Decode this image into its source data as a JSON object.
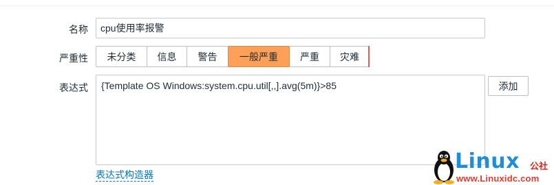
{
  "form": {
    "name": {
      "label": "名称",
      "value": "cpu使用率报警"
    },
    "severity": {
      "label": "严重性",
      "options": [
        {
          "label": "未分类",
          "selected": false,
          "color": "#97aab3"
        },
        {
          "label": "信息",
          "selected": false,
          "color": "#7499ff"
        },
        {
          "label": "警告",
          "selected": false,
          "color": "#ffc859"
        },
        {
          "label": "一般严重",
          "selected": true,
          "color": "#ffa059"
        },
        {
          "label": "严重",
          "selected": false,
          "color": "#e97659"
        },
        {
          "label": "灾难",
          "selected": false,
          "color": "#e45959"
        }
      ]
    },
    "expression": {
      "label": "表达式",
      "value": "{Template OS Windows:system.cpu.util[,,].avg(5m)}>85",
      "add_button": "添加",
      "constructor_link": "表达式构造器"
    }
  },
  "watermark": {
    "brand": "Linux",
    "suffix": "公社",
    "url": "www.Linuxidc.com"
  },
  "colors": {
    "selected_bg": "#ffa059",
    "link": "#0275b8"
  }
}
